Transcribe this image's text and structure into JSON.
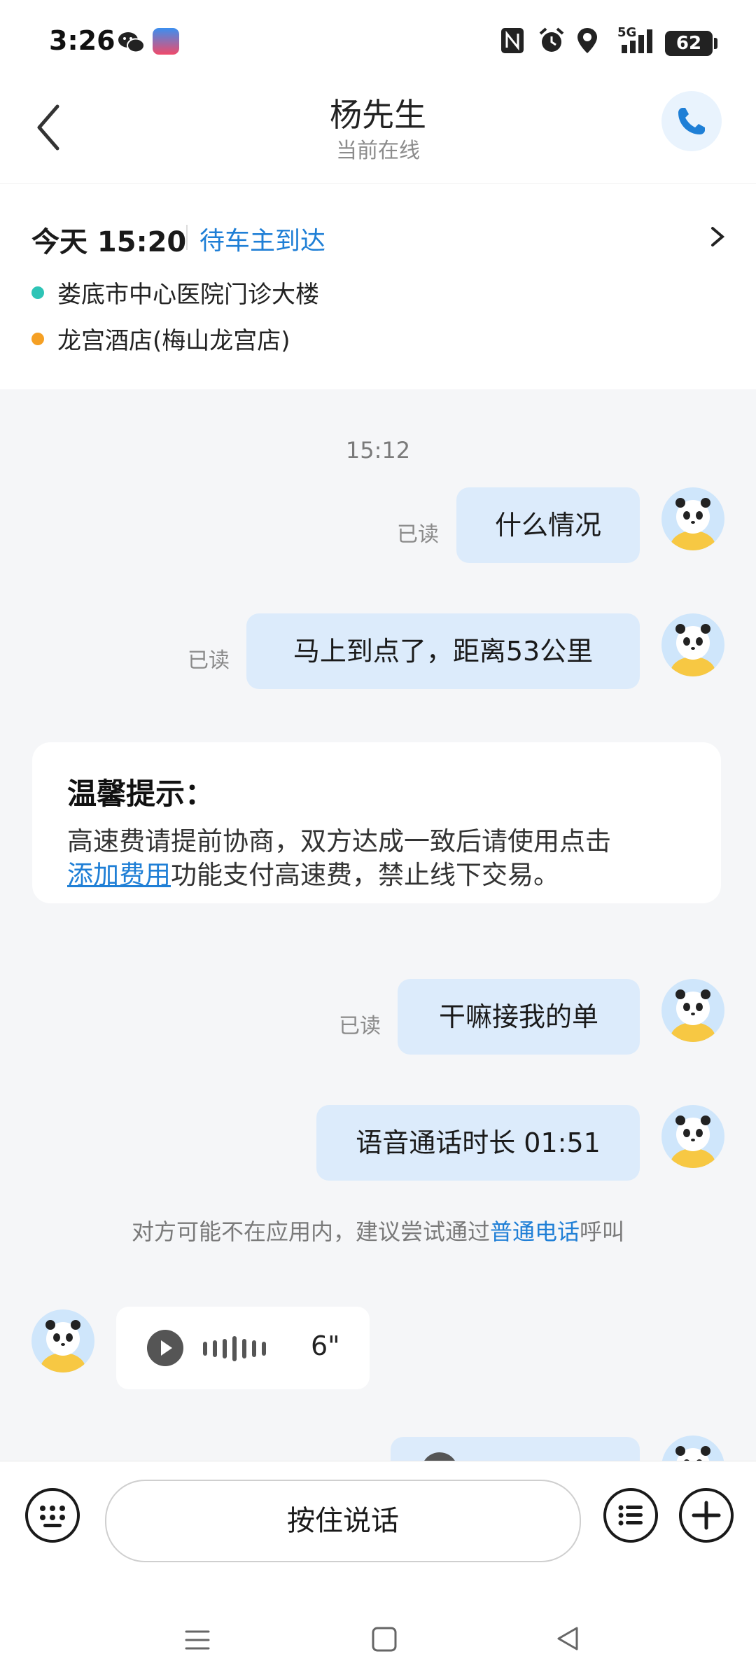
{
  "status_bar": {
    "time": "3:26",
    "network": "5G",
    "battery": "62"
  },
  "header": {
    "title": "杨先生",
    "subtitle": "当前在线"
  },
  "trip": {
    "time": "今天 15:20",
    "status": "待车主到达",
    "pickup": "娄底市中心医院门诊大楼",
    "dropoff": "龙宫酒店(梅山龙宫店)",
    "pickup_color": "#2ec4b6",
    "dropoff_color": "#f5a024"
  },
  "chat": {
    "timestamp": "15:12",
    "read_label": "已读",
    "messages": [
      {
        "text": "什么情况"
      },
      {
        "text": "马上到点了，距离53公里"
      },
      {
        "text": "干嘛接我的单"
      },
      {
        "text": "语音通话时长 01:51"
      }
    ],
    "tip": {
      "title": "温馨提示：",
      "line1": "高速费请提前协商，双方达成一致后请使用点击",
      "link": "添加费用",
      "line2_rest": "功能支付高速费，禁止线下交易。"
    },
    "notice": {
      "before": "对方可能不在应用内，建议尝试通过",
      "link": "普通电话",
      "after": "呼叫"
    },
    "voice": {
      "duration": "6\""
    }
  },
  "input_bar": {
    "hold_to_talk": "按住说话"
  },
  "colors": {
    "accent": "#1f7fd6",
    "bubble": "#dcebfb",
    "chat_bg": "#f5f6f8"
  }
}
